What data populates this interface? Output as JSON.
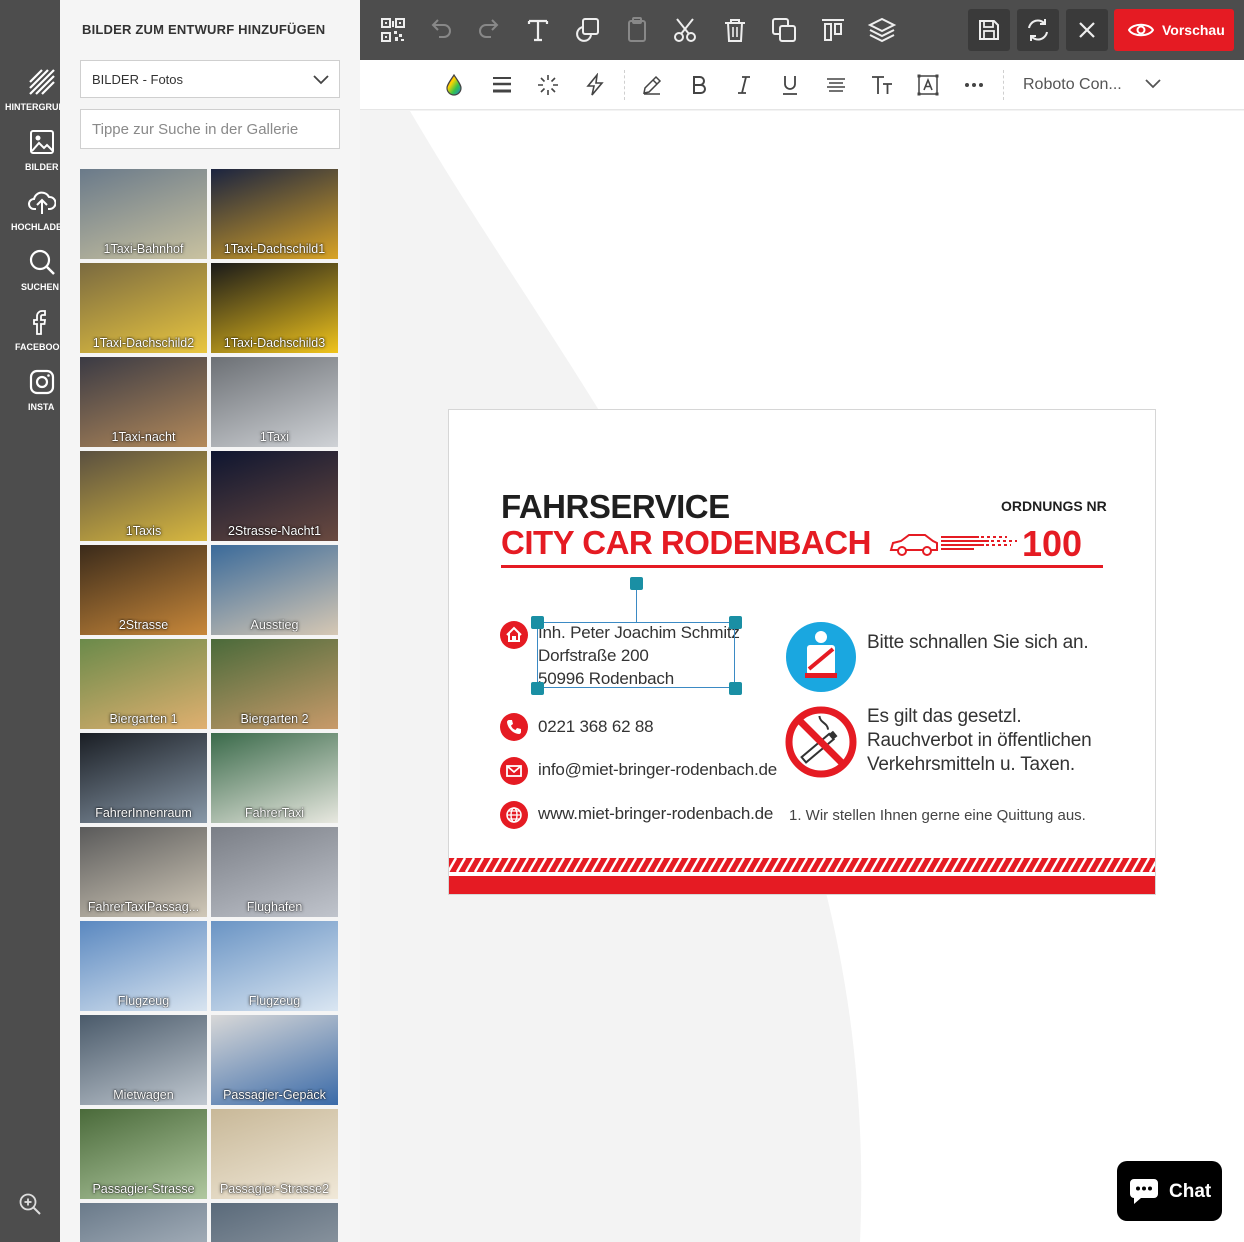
{
  "rail": {
    "items": [
      {
        "label": "HINTERGRUND",
        "icon": "background-icon"
      },
      {
        "label": "BILDER",
        "icon": "image-icon"
      },
      {
        "label": "HOCHLADEN",
        "icon": "upload-icon"
      },
      {
        "label": "SUCHEN",
        "icon": "search-icon"
      },
      {
        "label": "FACEBOOK",
        "icon": "facebook-icon"
      },
      {
        "label": "INSTA",
        "icon": "instagram-icon"
      }
    ]
  },
  "panel": {
    "title": "BILDER ZUM ENTWURF HINZUFÜGEN",
    "category": "BILDER - Fotos",
    "search_placeholder": "Tippe zur Suche in der Gallerie",
    "images": [
      "1Taxi-Bahnhof",
      "1Taxi-Dachschild1",
      "1Taxi-Dachschild2",
      "1Taxi-Dachschild3",
      "1Taxi-nacht",
      "1Taxi",
      "1Taxis",
      "2Strasse-Nacht1",
      "2Strasse",
      "Ausstieg",
      "Biergarten 1",
      "Biergarten 2",
      "FahrerInnenraum",
      "FahrerTaxi",
      "FahrerTaxiPassag...",
      "Flughafen",
      "Flugzeug",
      "Flugzeug",
      "Mietwagen",
      "Passagier-Gepäck",
      "Passagier-Strasse",
      "Passagier-Strasse2",
      "",
      ""
    ]
  },
  "toolbar": {
    "preview_label": "Vorschau"
  },
  "format": {
    "font_name": "Roboto Con..."
  },
  "card": {
    "heading1": "FAHRSERVICE",
    "heading2": "CITY CAR RODENBACH",
    "order_label": "ORDNUNGS NR",
    "order_number": "100",
    "address": [
      "Inh. Peter Joachim Schmitz",
      "Dorfstraße 200",
      "50996 Rodenbach"
    ],
    "phone": "0221 368 62 88",
    "email": "info@miet-bringer-rodenbach.de",
    "web": "www.miet-bringer-rodenbach.de",
    "seatbelt_note": "Bitte schnallen Sie sich an.",
    "smoking_note": [
      "Es gilt das gesetzl.",
      "Rauchverbot in öffentlichen",
      "Verkehrsmitteln u. Taxen."
    ],
    "footnote": "1. Wir stellen Ihnen gerne eine Quittung aus."
  },
  "chat": {
    "label": "Chat"
  },
  "colors": {
    "accent": "#e51b23",
    "dark": "#4d4d4d",
    "handle": "#1a8fa4",
    "sign_blue": "#1aa7e0"
  }
}
